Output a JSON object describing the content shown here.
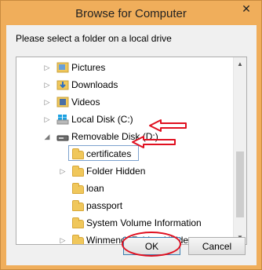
{
  "window": {
    "title": "Browse for Computer",
    "close_glyph": "✕"
  },
  "prompt": "Please select a folder on a local drive",
  "tree": {
    "items": [
      {
        "label": "Pictures",
        "icon": "pictures-library-icon",
        "expander": "collapsed"
      },
      {
        "label": "Downloads",
        "icon": "downloads-folder-icon",
        "expander": "collapsed"
      },
      {
        "label": "Videos",
        "icon": "videos-library-icon",
        "expander": "collapsed"
      },
      {
        "label": "Local Disk (C:)",
        "icon": "windows-drive-icon",
        "expander": "collapsed"
      },
      {
        "label": "Removable Disk (D:)",
        "icon": "usb-drive-icon",
        "expander": "expanded"
      },
      {
        "label": "certificates",
        "icon": "folder-icon",
        "expander": "none",
        "selected": true
      },
      {
        "label": "Folder Hidden",
        "icon": "folder-icon",
        "expander": "collapsed"
      },
      {
        "label": "loan",
        "icon": "folder-icon",
        "expander": "none"
      },
      {
        "label": "passport",
        "icon": "folder-icon",
        "expander": "none"
      },
      {
        "label": "System Volume Information",
        "icon": "folder-icon",
        "expander": "none"
      },
      {
        "label": "Winmend~Folder~Hidden",
        "icon": "folder-icon",
        "expander": "collapsed"
      }
    ]
  },
  "buttons": {
    "ok": "OK",
    "cancel": "Cancel"
  },
  "colors": {
    "frame": "#f0ae5b",
    "annotation": "#e01020",
    "selection_border": "#7da2ce"
  }
}
